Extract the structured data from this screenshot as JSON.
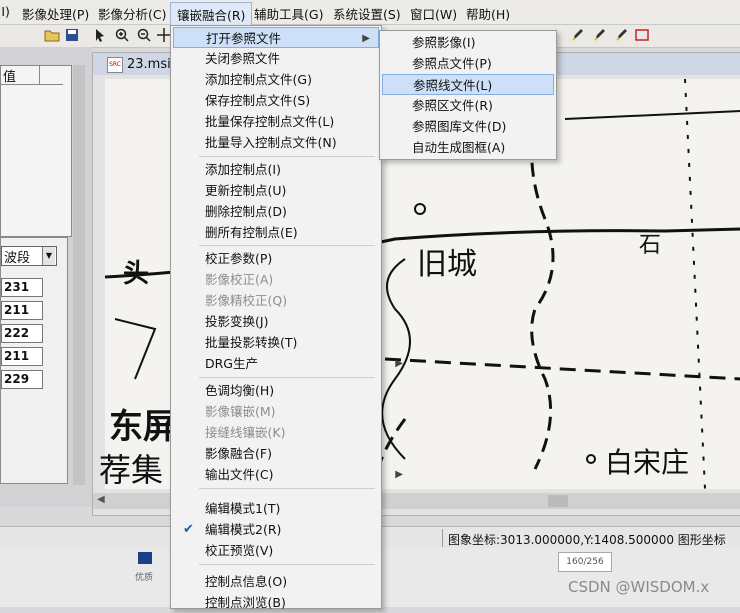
{
  "menubar": {
    "items": [
      {
        "label": "ιΎ·β(I)"
      },
      {
        "label": "影像处理(P)"
      },
      {
        "label": "影像分析(C)"
      },
      {
        "label": "镶嵌融合(R)"
      },
      {
        "label": "辅助工具(G)"
      },
      {
        "label": "系统设置(S)"
      },
      {
        "label": "窗口(W)"
      },
      {
        "label": "帮助(H)"
      }
    ]
  },
  "document": {
    "title": "23.msi",
    "icon_text": "SRC"
  },
  "left_panel": {
    "header_text": "值",
    "combo_value": "波段",
    "values": [
      "231",
      "211",
      "222",
      "211",
      "229"
    ]
  },
  "map": {
    "labels": {
      "old_city": "旧城",
      "shi": "石",
      "tou": "头",
      "baisongzhuang": "白宋庄",
      "dong": "东屏",
      "ji": "荐集"
    }
  },
  "main_menu": {
    "items": [
      {
        "label": "打开参照文件",
        "submenu": true,
        "highlight": true
      },
      {
        "label": "关闭参照文件",
        "submenu": true
      },
      {
        "label": "添加控制点文件(G)"
      },
      {
        "label": "保存控制点文件(S)"
      },
      {
        "label": "批量保存控制点文件(L)"
      },
      {
        "label": "批量导入控制点文件(N)"
      },
      {
        "label": "添加控制点(I)"
      },
      {
        "label": "更新控制点(U)"
      },
      {
        "label": "删除控制点(D)"
      },
      {
        "label": "删所有控制点(E)"
      },
      {
        "label": "校正参数(P)"
      },
      {
        "label": "影像校正(A)",
        "disabled": true
      },
      {
        "label": "影像精校正(Q)",
        "disabled": true
      },
      {
        "label": "投影变换(J)"
      },
      {
        "label": "批量投影转换(T)"
      },
      {
        "label": "DRG生产",
        "submenu": true
      },
      {
        "label": "色调均衡(H)"
      },
      {
        "label": "影像镶嵌(M)",
        "disabled": true
      },
      {
        "label": "接缝线镶嵌(K)",
        "disabled": true
      },
      {
        "label": "影像融合(F)"
      },
      {
        "label": "输出文件(C)",
        "submenu": true
      },
      {
        "label": "编辑模式1(T)"
      },
      {
        "label": "编辑模式2(R)",
        "checked": true
      },
      {
        "label": "校正预览(V)"
      },
      {
        "label": "控制点信息(O)"
      },
      {
        "label": "控制点浏览(B)"
      }
    ]
  },
  "submenu": {
    "items": [
      {
        "label": "参照影像(I)"
      },
      {
        "label": "参照点文件(P)"
      },
      {
        "label": "参照线文件(L)",
        "highlight": true
      },
      {
        "label": "参照区文件(R)"
      },
      {
        "label": "参照图库文件(D)"
      },
      {
        "label": "自动生成图框(A)"
      }
    ]
  },
  "statusbar": {
    "coords": "图象坐标:3013.000000,Y:1408.500000  图形坐标"
  },
  "bottom": {
    "page_count": "160/256",
    "watermark": "CSDN @WISDOM.x",
    "small_text": "优质"
  }
}
